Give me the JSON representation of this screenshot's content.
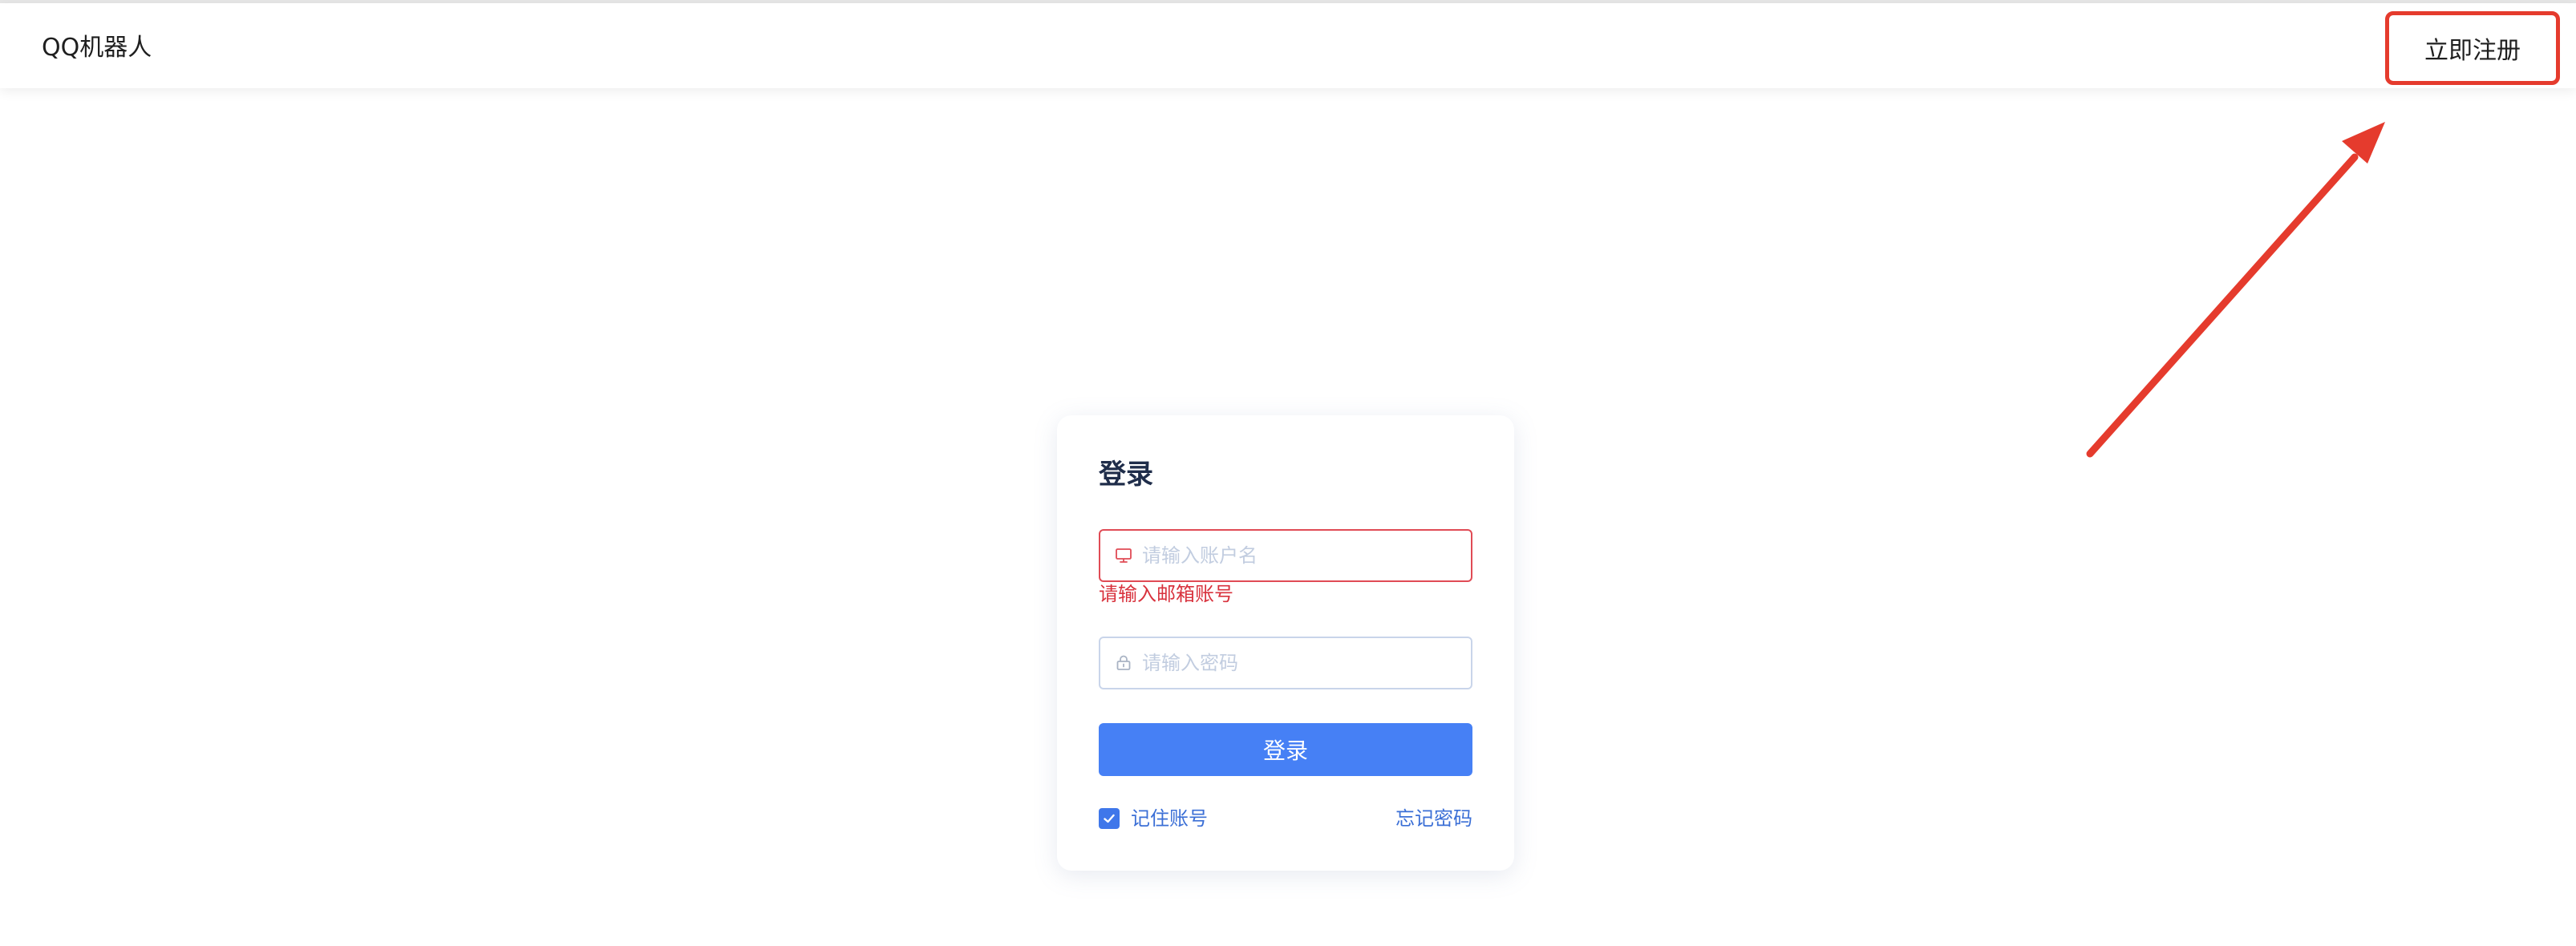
{
  "header": {
    "app_title": "QQ机器人",
    "register_label": "立即注册"
  },
  "login": {
    "title": "登录",
    "username_placeholder": "请输入账户名",
    "username_value": "",
    "username_error": "请输入邮箱账号",
    "password_placeholder": "请输入密码",
    "password_value": "",
    "submit_label": "登录",
    "remember_label": "记住账号",
    "remember_checked": true,
    "forgot_label": "忘记密码"
  },
  "icons": {
    "username": "monitor-icon",
    "password": "lock-icon",
    "checkbox": "check-icon"
  },
  "colors": {
    "primary": "#4680f5",
    "link": "#3b6fd6",
    "error": "#d8323d",
    "annotation": "#e53b2d"
  }
}
